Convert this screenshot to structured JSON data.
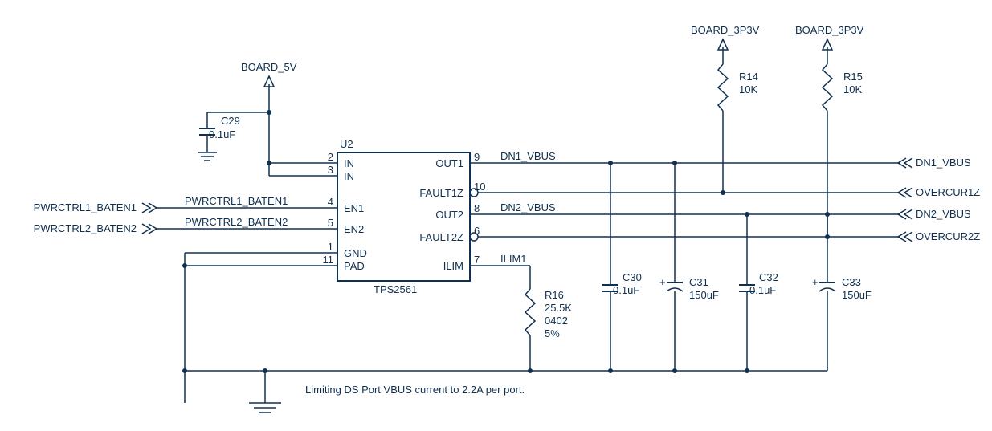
{
  "power": {
    "v5": "BOARD_5V",
    "v3p3_a": "BOARD_3P3V",
    "v3p3_b": "BOARD_3P3V"
  },
  "ports_left": {
    "p1": "PWRCTRL1_BATEN1",
    "p2": "PWRCTRL2_BATEN2",
    "p1_net": "PWRCTRL1_BATEN1",
    "p2_net": "PWRCTRL2_BATEN2"
  },
  "ports_right": {
    "dn1": "DN1_VBUS",
    "oc1": "OVERCUR1Z",
    "dn2": "DN2_VBUS",
    "oc2": "OVERCUR2Z"
  },
  "nets": {
    "dn1": "DN1_VBUS",
    "dn2": "DN2_VBUS",
    "ilim": "ILIM1"
  },
  "ic": {
    "ref": "U2",
    "type": "TPS2561",
    "pins": {
      "in_a": "IN",
      "in_a_n": "2",
      "in_b": "IN",
      "in_b_n": "3",
      "en1": "EN1",
      "en1_n": "4",
      "en2": "EN2",
      "en2_n": "5",
      "gnd": "GND",
      "gnd_n": "1",
      "pad": "PAD",
      "pad_n": "11",
      "out1": "OUT1",
      "out1_n": "9",
      "f1": "FAULT1Z",
      "f1_n": "10",
      "out2": "OUT2",
      "out2_n": "8",
      "f2": "FAULT2Z",
      "f2_n": "6",
      "ilim": "ILIM",
      "ilim_n": "7"
    }
  },
  "caps": {
    "c29": {
      "ref": "C29",
      "val": "0.1uF"
    },
    "c30": {
      "ref": "C30",
      "val": "0.1uF"
    },
    "c31": {
      "ref": "C31",
      "val": "150uF"
    },
    "c32": {
      "ref": "C32",
      "val": "0.1uF"
    },
    "c33": {
      "ref": "C33",
      "val": "150uF"
    }
  },
  "res": {
    "r14": {
      "ref": "R14",
      "val": "10K"
    },
    "r15": {
      "ref": "R15",
      "val": "10K"
    },
    "r16": {
      "ref": "R16",
      "val": "25.5K",
      "pkg": "0402",
      "tol": "5%"
    }
  },
  "note": "Limiting DS Port VBUS current to 2.2A per port."
}
